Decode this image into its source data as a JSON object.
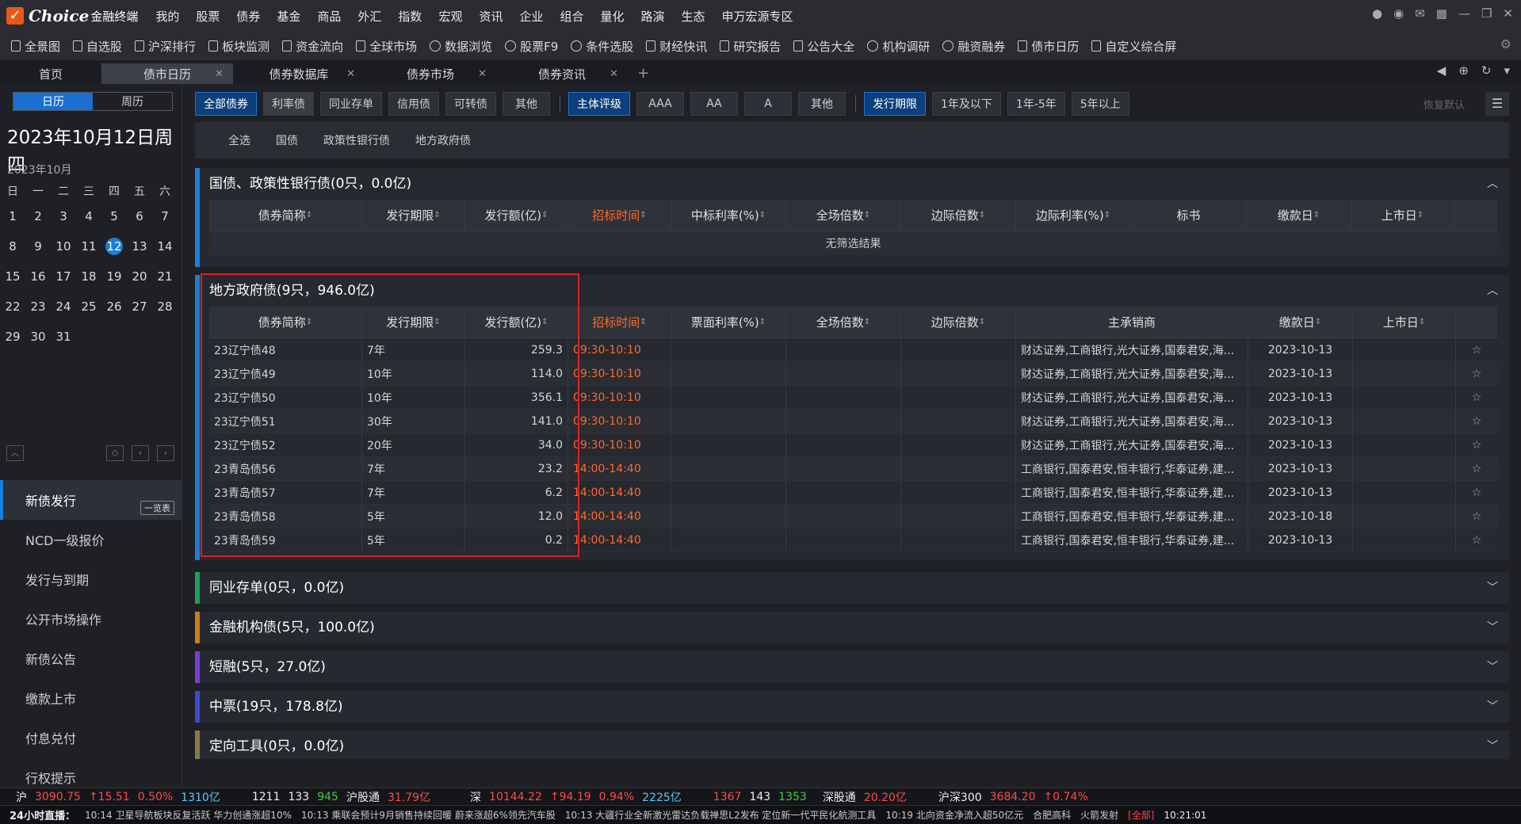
{
  "app": {
    "brand": "Choice",
    "brand_sub": "金融终端"
  },
  "menu": [
    "我的",
    "股票",
    "债券",
    "基金",
    "商品",
    "外汇",
    "指数",
    "宏观",
    "资讯",
    "企业",
    "组合",
    "量化",
    "路演",
    "生态",
    "申万宏源专区"
  ],
  "toolbar": [
    "全景图",
    "自选股",
    "沪深排行",
    "板块监测",
    "资金流向",
    "全球市场",
    "数据浏览",
    "股票F9",
    "条件选股",
    "财经快讯",
    "研究报告",
    "公告大全",
    "机构调研",
    "融资融券",
    "债市日历",
    "自定义综合屏"
  ],
  "tabs": {
    "home": "首页",
    "items": [
      "债市日历",
      "债券数据库",
      "债券市场",
      "债券资讯"
    ]
  },
  "sidebar": {
    "view_day": "日历",
    "view_week": "周历",
    "big_date": "2023年10月12日周四",
    "month": "2023年10月",
    "weekdays": [
      "日",
      "一",
      "二",
      "三",
      "四",
      "五",
      "六"
    ],
    "weeks": [
      [
        "1",
        "2",
        "3",
        "4",
        "5",
        "6",
        "7"
      ],
      [
        "8",
        "9",
        "10",
        "11",
        "12",
        "13",
        "14"
      ],
      [
        "15",
        "16",
        "17",
        "18",
        "19",
        "20",
        "21"
      ],
      [
        "22",
        "23",
        "24",
        "25",
        "26",
        "27",
        "28"
      ],
      [
        "29",
        "30",
        "31",
        "",
        "",
        "",
        ""
      ]
    ],
    "selected_day": "12",
    "nav": [
      "新债发行",
      "NCD一级报价",
      "发行与到期",
      "公开市场操作",
      "新债公告",
      "缴款上市",
      "付息兑付",
      "行权提示"
    ],
    "nav_badge": "一览表"
  },
  "filters": {
    "g1": [
      "全部债券",
      "利率债",
      "同业存单",
      "信用债",
      "可转债",
      "其他"
    ],
    "g2": [
      "主体评级",
      "AAA",
      "AA",
      "A",
      "其他"
    ],
    "g3": [
      "发行期限",
      "1年及以下",
      "1年-5年",
      "5年以上"
    ],
    "reset": "恢复默认",
    "sub": [
      "全选",
      "国债",
      "政策性银行债",
      "地方政府债"
    ]
  },
  "colors": {
    "bar1": "#1a7fd8",
    "bar2": "#1a7fd8",
    "bar3": "#1e9e58",
    "bar4": "#c87d1e",
    "bar5": "#7a3fd1",
    "bar6": "#3c4ad1",
    "bar7": "#8a7a4a"
  },
  "section1": {
    "title": "国债、政策性银行债(0只，0.0亿)",
    "headers": [
      "债券简称",
      "发行期限",
      "发行额(亿)",
      "招标时间",
      "中标利率(%)",
      "全场倍数",
      "边际倍数",
      "边际利率(%)",
      "标书",
      "缴款日",
      "上市日"
    ],
    "noresult": "无筛选结果"
  },
  "section2": {
    "title": "地方政府债(9只，946.0亿)",
    "headers": [
      "债券简称",
      "发行期限",
      "发行额(亿)",
      "招标时间",
      "票面利率(%)",
      "全场倍数",
      "边际倍数",
      "主承销商",
      "缴款日",
      "上市日"
    ],
    "rows": [
      [
        "23辽宁债48",
        "7年",
        "259.3",
        "09:30-10:10",
        "财达证券,工商银行,光大证券,国泰君安,海...",
        "2023-10-13"
      ],
      [
        "23辽宁债49",
        "10年",
        "114.0",
        "09:30-10:10",
        "财达证券,工商银行,光大证券,国泰君安,海...",
        "2023-10-13"
      ],
      [
        "23辽宁债50",
        "10年",
        "356.1",
        "09:30-10:10",
        "财达证券,工商银行,光大证券,国泰君安,海...",
        "2023-10-13"
      ],
      [
        "23辽宁债51",
        "30年",
        "141.0",
        "09:30-10:10",
        "财达证券,工商银行,光大证券,国泰君安,海...",
        "2023-10-13"
      ],
      [
        "23辽宁债52",
        "20年",
        "34.0",
        "09:30-10:10",
        "财达证券,工商银行,光大证券,国泰君安,海...",
        "2023-10-13"
      ],
      [
        "23青岛债56",
        "7年",
        "23.2",
        "14:00-14:40",
        "工商银行,国泰君安,恒丰银行,华泰证券,建...",
        "2023-10-13"
      ],
      [
        "23青岛债57",
        "7年",
        "6.2",
        "14:00-14:40",
        "工商银行,国泰君安,恒丰银行,华泰证券,建...",
        "2023-10-13"
      ],
      [
        "23青岛债58",
        "5年",
        "12.0",
        "14:00-14:40",
        "工商银行,国泰君安,恒丰银行,华泰证券,建...",
        "2023-10-18"
      ],
      [
        "23青岛债59",
        "5年",
        "0.2",
        "14:00-14:40",
        "工商银行,国泰君安,恒丰银行,华泰证券,建...",
        "2023-10-13"
      ]
    ]
  },
  "collapsed": [
    "同业存单(0只，0.0亿)",
    "金融机构债(5只，100.0亿)",
    "短融(5只，27.0亿)",
    "中票(19只，178.8亿)",
    "定向工具(0只，0.0亿)"
  ],
  "status1": [
    "沪",
    "3090.75",
    "↑15.51",
    "0.50%",
    "1310亿",
    "1211",
    "133",
    "945",
    "沪股通",
    "31.79亿",
    "深",
    "10144.22",
    "↑94.19",
    "0.94%",
    "2225亿",
    "1367",
    "143",
    "1353",
    "深股通",
    "20.20亿",
    "沪深300",
    "3684.20",
    "↑0.74%"
  ],
  "status2": [
    "24小时直播：",
    "10:14 卫星导航板块反复活跃 华力创通涨超10%",
    "10:13 乘联会预计9月销售持续回暖 蔚来涨超6%领先汽车股",
    "10:13 大疆行业全新激光雷达负载禅思L2发布 定位新一代平民化航测工具",
    "10:19 北向资金净流入超50亿元",
    "合肥高科",
    "火箭发射",
    "[全部]",
    "10:21:01"
  ]
}
